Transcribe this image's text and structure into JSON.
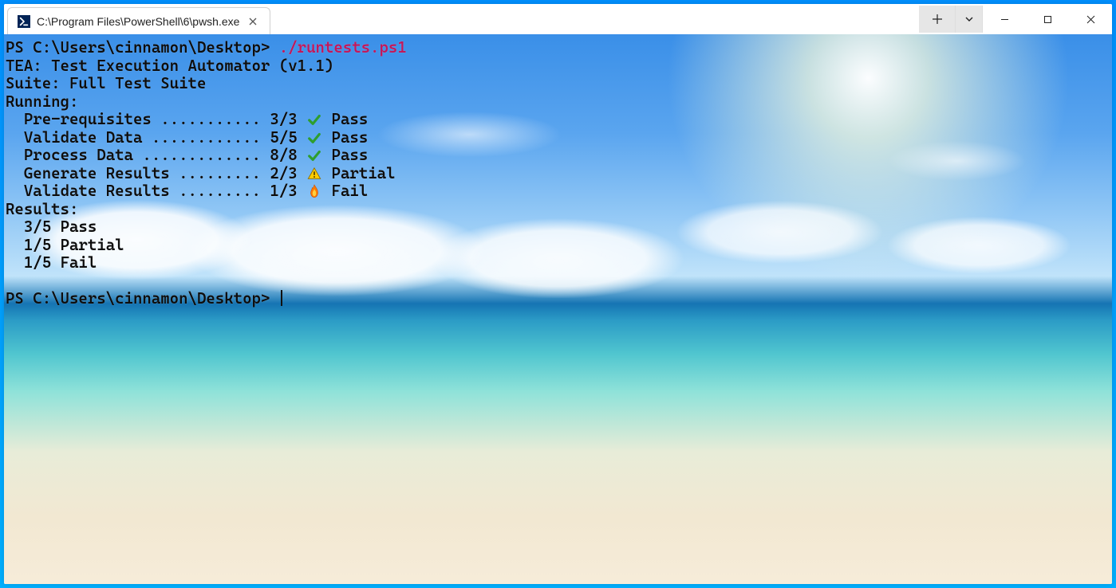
{
  "tab": {
    "title": "C:\\Program Files\\PowerShell\\6\\pwsh.exe"
  },
  "terminal": {
    "prompt1": "PS C:\\Users\\cinnamon\\Desktop>",
    "command": "./runtests.ps1",
    "app_line": "TEA: Test Execution Automator (v1.1)",
    "suite_line": "Suite: Full Test Suite",
    "running_label": "Running:",
    "tests": [
      {
        "name": "Pre-requisites",
        "dots": "...........",
        "score": "3/3",
        "status": "Pass",
        "icon": "pass"
      },
      {
        "name": "Validate Data",
        "dots": "............",
        "score": "5/5",
        "status": "Pass",
        "icon": "pass"
      },
      {
        "name": "Process Data",
        "dots": ".............",
        "score": "8/8",
        "status": "Pass",
        "icon": "pass"
      },
      {
        "name": "Generate Results",
        "dots": ".........",
        "score": "2/3",
        "status": "Partial",
        "icon": "warn"
      },
      {
        "name": "Validate Results",
        "dots": ".........",
        "score": "1/3",
        "status": "Fail",
        "icon": "fire"
      }
    ],
    "results_label": "Results:",
    "results": [
      "3/5 Pass",
      "1/5 Partial",
      "1/5 Fail"
    ],
    "prompt2": "PS C:\\Users\\cinnamon\\Desktop>"
  }
}
